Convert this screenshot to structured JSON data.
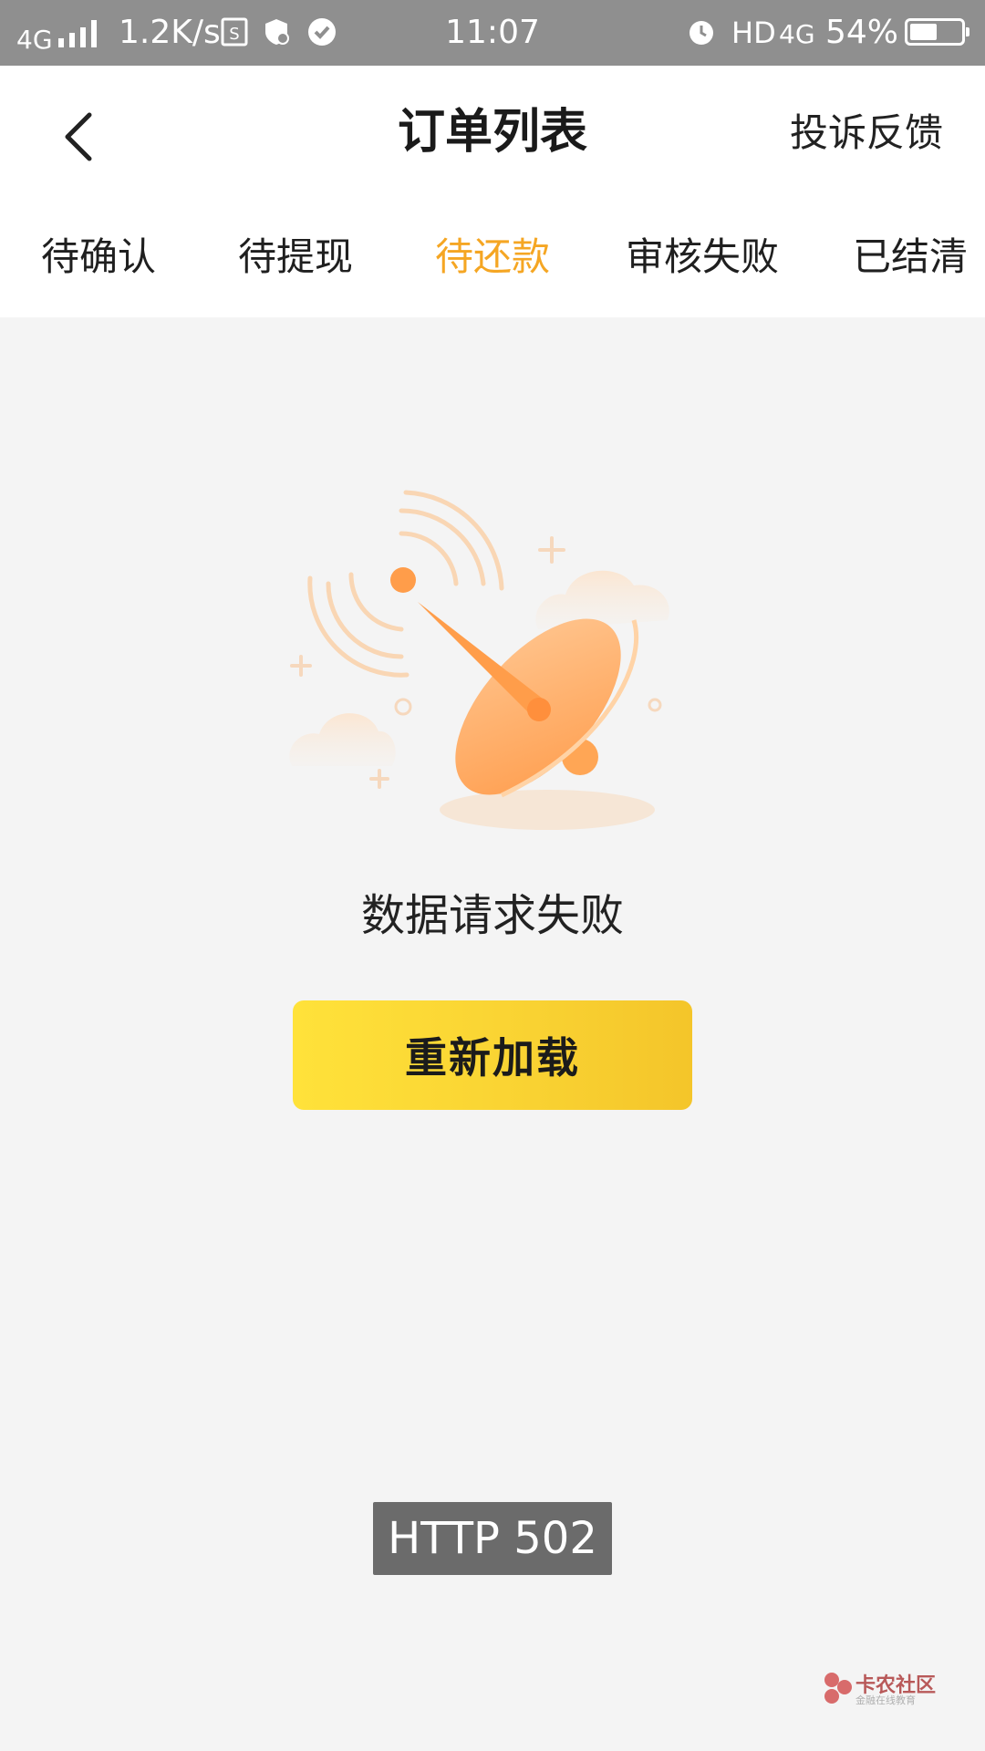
{
  "status_bar": {
    "network": "4G",
    "speed": "1.2K/s",
    "time": "11:07",
    "hd": "HD",
    "net_type": "4G",
    "battery": "54%",
    "battery_level": 0.54
  },
  "header": {
    "title": "订单列表",
    "feedback_label": "投诉反馈"
  },
  "tabs": [
    {
      "label": "待确认"
    },
    {
      "label": "待提现"
    },
    {
      "label": "待还款"
    },
    {
      "label": "审核失败"
    },
    {
      "label": "已结清"
    }
  ],
  "active_tab_index": 2,
  "colors": {
    "accent": "#f5a623",
    "button_start": "#ffe23a",
    "button_end": "#f4c52a"
  },
  "empty_state": {
    "message": "数据请求失败",
    "reload_label": "重新加载"
  },
  "toast": {
    "text": "HTTP 502"
  },
  "watermark": {
    "text": "卡农社区",
    "sub": "金融在线教育"
  }
}
